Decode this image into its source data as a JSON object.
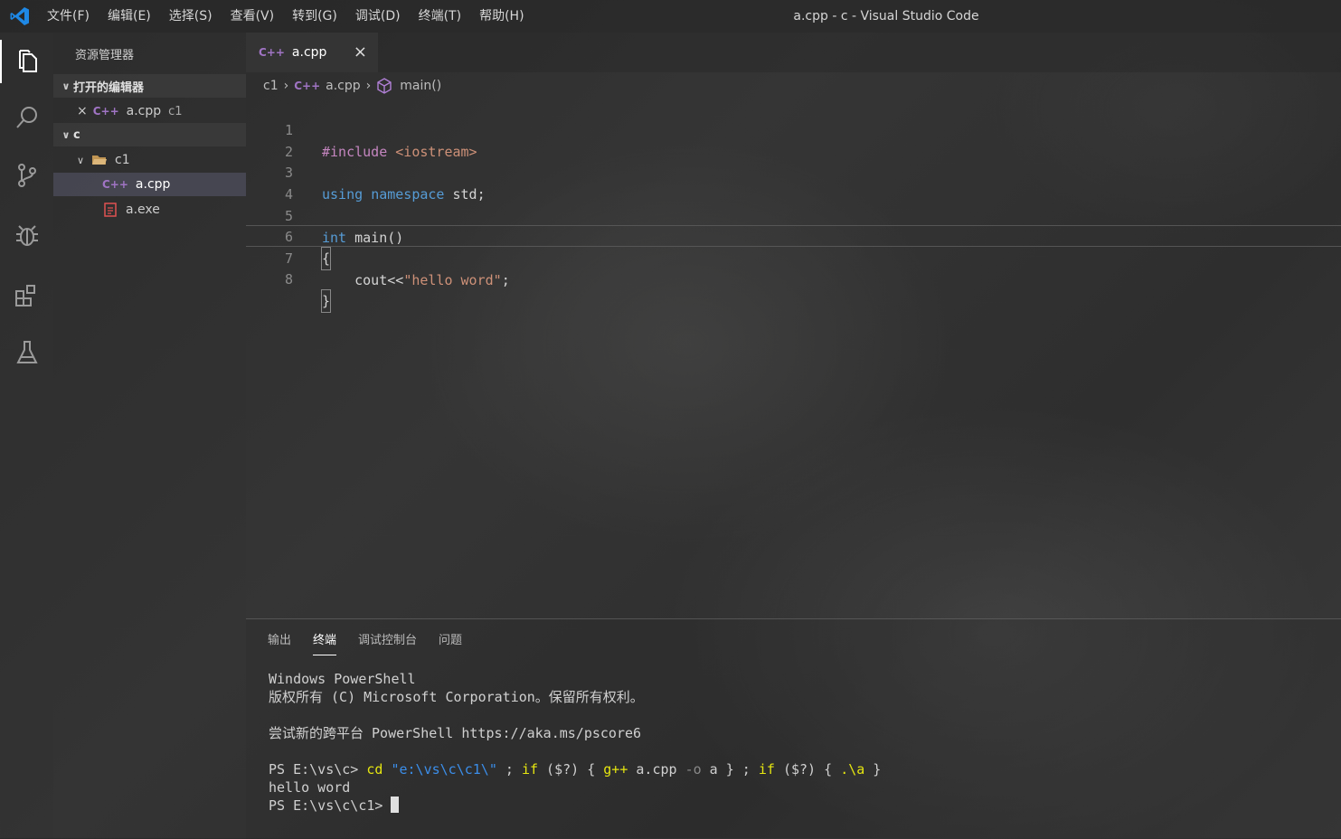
{
  "titlebar": {
    "menu": [
      "文件(F)",
      "编辑(E)",
      "选择(S)",
      "查看(V)",
      "转到(G)",
      "调试(D)",
      "终端(T)",
      "帮助(H)"
    ],
    "window_title": "a.cpp - c - Visual Studio Code"
  },
  "activitybar": {
    "icons": [
      "explorer-icon",
      "search-icon",
      "source-control-icon",
      "debug-icon",
      "extensions-icon",
      "test-flask-icon"
    ]
  },
  "sidebar": {
    "title": "资源管理器",
    "open_editors_label": "打开的编辑器",
    "open_editor_file": "a.cpp",
    "open_editor_desc": "c1",
    "folder_root": "c",
    "folder_c1": "c1",
    "file_cpp": "a.cpp",
    "file_exe": "a.exe"
  },
  "tab": {
    "label": "a.cpp",
    "icon_text": "C++"
  },
  "breadcrumb": {
    "folder": "c1",
    "file": "a.cpp",
    "symbol": "main()"
  },
  "editor": {
    "line_numbers": [
      "1",
      "2",
      "3",
      "4",
      "5",
      "6",
      "7",
      "8"
    ],
    "line1_kw": "#include",
    "line1_arg": "<iostream>",
    "line3_kw1": "using",
    "line3_kw2": "namespace",
    "line3_rest": "std;",
    "line5_kw": "int",
    "line5_rest": "main()",
    "line6": "{",
    "line7_pre": "    cout<<",
    "line7_str": "\"hello word\"",
    "line7_post": ";",
    "line8": "}"
  },
  "panel": {
    "tabs": [
      "输出",
      "终端",
      "调试控制台",
      "问题"
    ],
    "active_tab": "终端",
    "terminal": {
      "l1": "Windows PowerShell",
      "l2": "版权所有 (C) Microsoft Corporation。保留所有权利。",
      "l4": "尝试新的跨平台 PowerShell https://aka.ms/pscore6",
      "cmd_prompt": "PS E:\\vs\\c> ",
      "cmd_cd": "cd",
      "cmd_path": "\"e:\\vs\\c\\c1\\\"",
      "cmd_semi1": " ; ",
      "cmd_if1": "if",
      "cmd_cond1": " ($?) { ",
      "cmd_gpp": "g++",
      "cmd_file": " a.cpp ",
      "cmd_o": "-o",
      "cmd_a": " a } ; ",
      "cmd_if2": "if",
      "cmd_cond2": " ($?) { ",
      "cmd_run": ".\\a",
      "cmd_end": " }",
      "output": "hello word",
      "prompt2": "PS E:\\vs\\c\\c1> "
    }
  },
  "colors": {
    "keyword": "#569cd6",
    "include": "#c586c0",
    "string": "#ce9178",
    "cpp_icon": "#a074c4",
    "vscode_blue": "#1e88e5"
  }
}
